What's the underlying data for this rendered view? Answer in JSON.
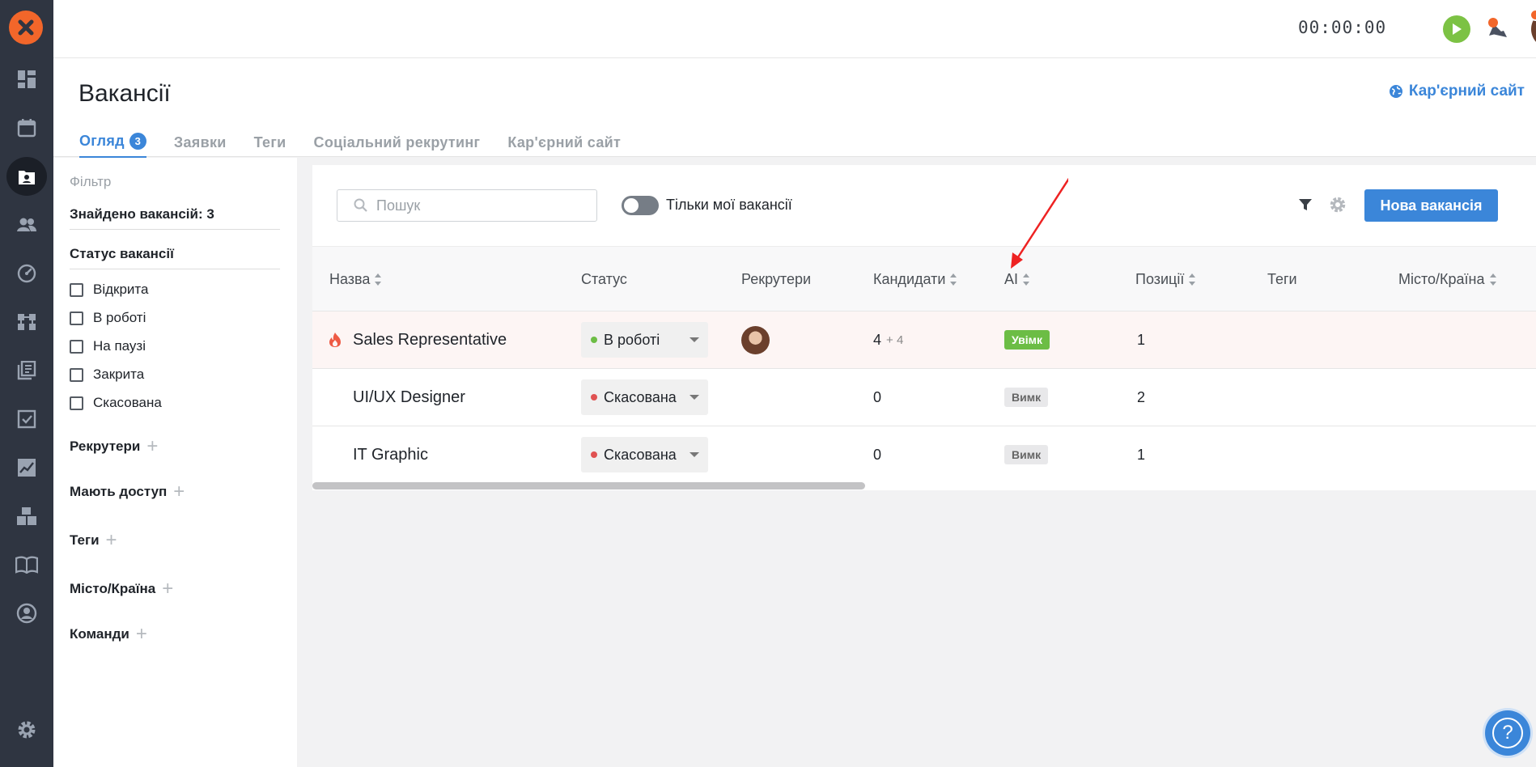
{
  "app": {
    "brand_color": "#f2662a",
    "accent": "#3b86d9"
  },
  "rail": {
    "items": [
      {
        "icon": "dashboard-icon"
      },
      {
        "icon": "calendar-icon"
      },
      {
        "icon": "vacancies-icon",
        "active": true
      },
      {
        "icon": "candidates-icon"
      },
      {
        "icon": "speedometer-icon"
      },
      {
        "icon": "workflow-icon"
      },
      {
        "icon": "library-icon"
      },
      {
        "icon": "tasks-icon"
      },
      {
        "icon": "analytics-icon"
      },
      {
        "icon": "integrations-icon"
      },
      {
        "icon": "knowledge-book-icon"
      },
      {
        "icon": "profile-icon"
      }
    ],
    "settings_icon": "gear-icon"
  },
  "topbar": {
    "timer": "00:00:00"
  },
  "page": {
    "title": "Вакансії",
    "career_link": "Кар'єрний сайт",
    "tabs": [
      {
        "label": "Огляд",
        "count": "3",
        "active": true
      },
      {
        "label": "Заявки"
      },
      {
        "label": "Теги"
      },
      {
        "label": "Соціальний рекрутинг"
      },
      {
        "label": "Кар'єрний сайт"
      }
    ]
  },
  "filter": {
    "title": "Фільтр",
    "found": "Знайдено вакансій: 3",
    "status_heading": "Статус вакансії",
    "statuses": [
      "Відкрита",
      "В роботі",
      "На паузі",
      "Закрита",
      "Скасована"
    ],
    "groups": [
      "Рекрутери",
      "Мають доступ",
      "Теги",
      "Місто/Країна",
      "Команди"
    ]
  },
  "toolbar": {
    "search_placeholder": "Пошук",
    "toggle_label": "Тільки мої вакансії",
    "new_button": "Нова вакансія"
  },
  "table": {
    "columns": [
      "Назва",
      "Статус",
      "Рекрутери",
      "Кандидати",
      "AI",
      "Позиції",
      "Теги",
      "Місто/Країна"
    ],
    "rows": [
      {
        "name": "Sales Representative",
        "hot": true,
        "status": "В роботі",
        "status_color": "#6cbd45",
        "candidates": "4",
        "candidates_extra": "+ 4",
        "ai": "Увімк",
        "ai_on": true,
        "positions": "1"
      },
      {
        "name": "UI/UX Designer",
        "status": "Скасована",
        "status_color": "#e05252",
        "candidates": "0",
        "ai": "Вимк",
        "ai_on": false,
        "positions": "2"
      },
      {
        "name": "IT Graphic",
        "status": "Скасована",
        "status_color": "#e05252",
        "candidates": "0",
        "ai": "Вимк",
        "ai_on": false,
        "positions": "1"
      }
    ]
  }
}
